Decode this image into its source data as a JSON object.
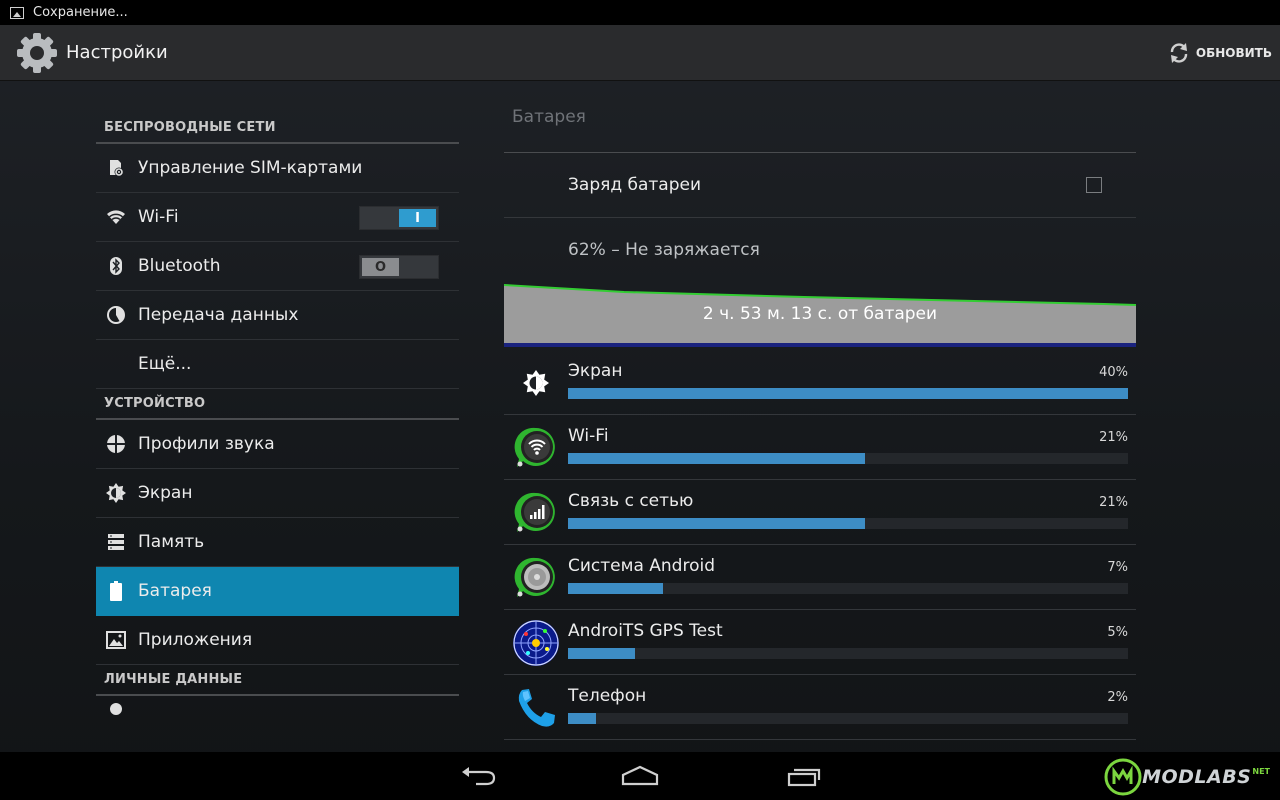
{
  "status_bar": {
    "text": "Сохранение..."
  },
  "action_bar": {
    "title": "Настройки",
    "refresh_label": "ОБНОВИТЬ"
  },
  "settings_list": {
    "sections": [
      {
        "header": "БЕСПРОВОДНЫЕ СЕТИ"
      },
      {
        "header": "УСТРОЙСТВО"
      },
      {
        "header": "ЛИЧНЫЕ ДАННЫЕ"
      }
    ],
    "wireless": [
      {
        "label": "Управление SIM-картами",
        "icon": "sim-settings-icon"
      },
      {
        "label": "Wi-Fi",
        "icon": "wifi-icon",
        "toggle": "on",
        "toggle_glyph": "I"
      },
      {
        "label": "Bluetooth",
        "icon": "bluetooth-icon",
        "toggle": "off",
        "toggle_glyph": "O"
      },
      {
        "label": "Передача данных",
        "icon": "data-usage-icon"
      },
      {
        "label": "Ещё..."
      }
    ],
    "device": [
      {
        "label": "Профили звука",
        "icon": "sound-profile-icon"
      },
      {
        "label": "Экран",
        "icon": "brightness-icon"
      },
      {
        "label": "Память",
        "icon": "storage-icon"
      },
      {
        "label": "Батарея",
        "icon": "battery-icon",
        "selected": true
      },
      {
        "label": "Приложения",
        "icon": "apps-icon"
      }
    ],
    "personal_partial": {
      "icon": "location-icon"
    }
  },
  "battery": {
    "title": "Батарея",
    "charge_label": "Заряд батареи",
    "charge_checked": false,
    "status": "62% – Не заряжается",
    "graph_label": "2 ч. 53 м. 13 с. от батареи",
    "graph_colors": {
      "fill": "#9c9c9c",
      "line": "#33cc33",
      "baseline": "#1a237e"
    },
    "usage": [
      {
        "label": "Экран",
        "percent_text": "40%",
        "fraction": 1.0,
        "icon": "screen-brightness-icon"
      },
      {
        "label": "Wi-Fi",
        "percent_text": "21%",
        "fraction": 0.53,
        "icon": "wifi-app-icon"
      },
      {
        "label": "Связь с сетью",
        "percent_text": "21%",
        "fraction": 0.53,
        "icon": "cell-signal-app-icon"
      },
      {
        "label": "Система Android",
        "percent_text": "7%",
        "fraction": 0.17,
        "icon": "android-system-icon"
      },
      {
        "label": "AndroiTS GPS Test",
        "percent_text": "5%",
        "fraction": 0.12,
        "icon": "gps-test-icon"
      },
      {
        "label": "Телефон",
        "percent_text": "2%",
        "fraction": 0.05,
        "icon": "phone-icon"
      }
    ]
  },
  "nav_bar": {
    "back": "back-icon",
    "home": "home-icon",
    "recents": "recents-icon"
  },
  "watermark": {
    "text": "MODLABS",
    "sup": "NET"
  },
  "colors": {
    "accent": "#0f86b0",
    "bar": "#3d8dc5",
    "toggle_on": "#2f9ccf"
  }
}
